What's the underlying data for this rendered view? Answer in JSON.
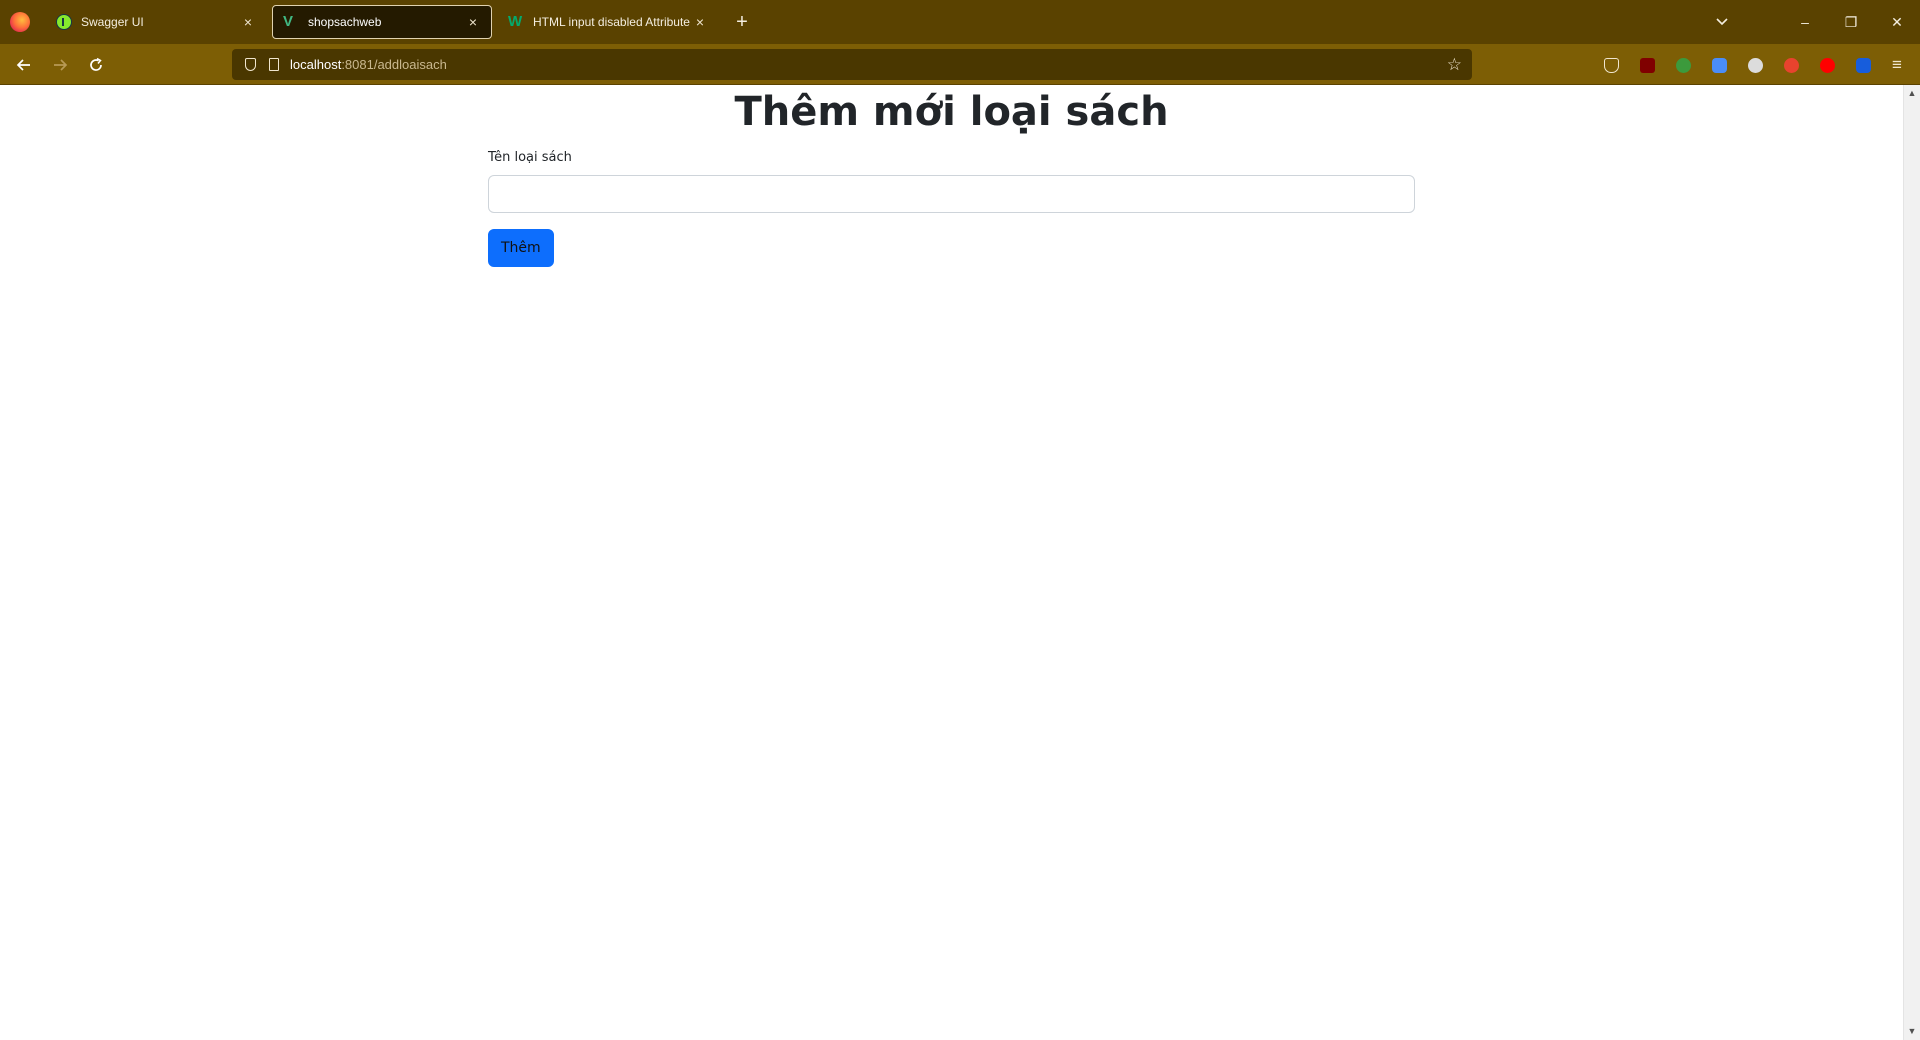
{
  "browser": {
    "tabs": [
      {
        "label": "Swagger UI",
        "icon": "swagger-icon",
        "active": false
      },
      {
        "label": "shopsachweb",
        "icon": "vue-icon",
        "active": true
      },
      {
        "label": "HTML input disabled Attribute",
        "icon": "w3schools-icon",
        "active": false
      }
    ],
    "close_glyph": "×",
    "new_tab_glyph": "+",
    "url_host": "localhost",
    "url_path": ":8081/addloaisach",
    "window_controls": {
      "minimize": "–",
      "restore": "❐",
      "close": "✕"
    },
    "extensions": [
      {
        "name": "pocket-icon",
        "color": "#f0e6cf"
      },
      {
        "name": "ublock-icon",
        "color": "#800000"
      },
      {
        "name": "globe-extension-icon",
        "color": "#3c9a3c"
      },
      {
        "name": "translate-icon",
        "color": "#4a8df8"
      },
      {
        "name": "eye-extension-icon",
        "color": "#dcdcdc"
      },
      {
        "name": "power-extension-icon",
        "color": "#e8432e"
      },
      {
        "name": "youtube-extension-icon",
        "color": "#ff0000"
      },
      {
        "name": "bitwarden-icon",
        "color": "#175ddc"
      }
    ]
  },
  "page": {
    "title": "Thêm mới loại sách",
    "field_label": "Tên loại sách",
    "field_value": "",
    "submit_label": "Thêm"
  }
}
